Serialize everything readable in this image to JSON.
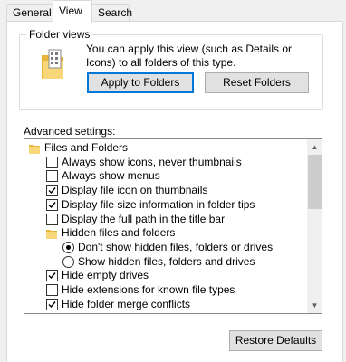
{
  "tabs": [
    {
      "label": "General"
    },
    {
      "label": "View"
    },
    {
      "label": "Search"
    }
  ],
  "folder_views": {
    "legend": "Folder views",
    "description": "You can apply this view (such as Details or Icons) to all folders of this type.",
    "apply_button": "Apply to Folders",
    "reset_button": "Reset Folders"
  },
  "advanced": {
    "label": "Advanced settings:",
    "items": [
      {
        "type": "folder",
        "label": "Files and Folders"
      },
      {
        "type": "checkbox",
        "checked": false,
        "label": "Always show icons, never thumbnails"
      },
      {
        "type": "checkbox",
        "checked": false,
        "label": "Always show menus"
      },
      {
        "type": "checkbox",
        "checked": true,
        "label": "Display file icon on thumbnails"
      },
      {
        "type": "checkbox",
        "checked": true,
        "label": "Display file size information in folder tips"
      },
      {
        "type": "checkbox",
        "checked": false,
        "label": "Display the full path in the title bar"
      },
      {
        "type": "folder",
        "label": "Hidden files and folders"
      },
      {
        "type": "radio",
        "checked": true,
        "label": "Don't show hidden files, folders or drives"
      },
      {
        "type": "radio",
        "checked": false,
        "label": "Show hidden files, folders and drives"
      },
      {
        "type": "checkbox",
        "checked": true,
        "label": "Hide empty drives"
      },
      {
        "type": "checkbox",
        "checked": false,
        "label": "Hide extensions for known file types"
      },
      {
        "type": "checkbox",
        "checked": true,
        "label": "Hide folder merge conflicts"
      }
    ]
  },
  "restore_button": "Restore Defaults",
  "icons": {
    "folder": "folder-icon",
    "folder_views": "folder-views-icon",
    "scroll_up": "chevron-up-icon",
    "scroll_down": "chevron-down-icon"
  },
  "colors": {
    "folder_yellow": "#f3c94f",
    "default_button_border": "#0078d7",
    "panel_bg": "#ffffff",
    "window_bg": "#f0f0f0"
  }
}
